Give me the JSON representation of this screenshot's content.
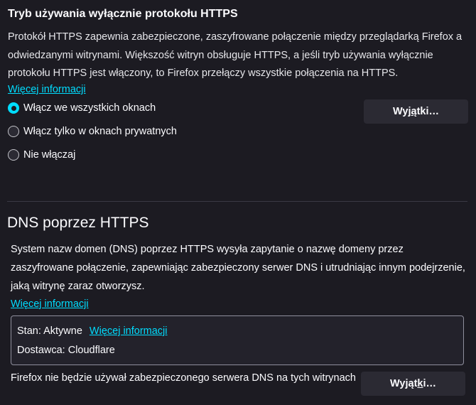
{
  "https_only": {
    "title": "Tryb używania wyłącznie protokołu HTTPS",
    "description": "Protokół HTTPS zapewnia zabezpieczone, zaszyfrowane połączenie między przeglądarką Firefox a odwiedzanymi witrynami. Większość witryn obsługuje HTTPS, a jeśli tryb używania wyłącznie protokołu HTTPS jest włączony, to Firefox przełączy wszystkie połączenia na HTTPS.",
    "learn_more": "Więcej informacji",
    "options": [
      {
        "label": "Włącz we wszystkich oknach",
        "checked": true
      },
      {
        "label": "Włącz tylko w oknach prywatnych",
        "checked": false
      },
      {
        "label": "Nie włączaj",
        "checked": false
      }
    ],
    "exceptions_button": {
      "before": "Wyj",
      "accesskey": "ą",
      "after": "tki…"
    }
  },
  "dns_over_https": {
    "title": "DNS poprzez HTTPS",
    "description": "System nazw domen (DNS) poprzez HTTPS wysyła zapytanie o nazwę domeny przez zaszyfrowane połączenie, zapewniając zabezpieczony serwer DNS i utrudniając innym podejrzenie, jaką witrynę zaraz otworzysz.",
    "learn_more": "Więcej informacji",
    "status": {
      "status_text": "Stan: Aktywne",
      "status_link": "Więcej informacji",
      "provider_text": "Dostawca: Cloudflare"
    },
    "note": "Firefox nie będzie używał zabezpieczonego serwera DNS na tych witrynach",
    "exceptions_button": {
      "before": "Wyjąt",
      "accesskey": "k",
      "after": "i…"
    }
  },
  "colors": {
    "background": "#1c1b22",
    "accent": "#00ddff",
    "button": "#2b2a33"
  }
}
